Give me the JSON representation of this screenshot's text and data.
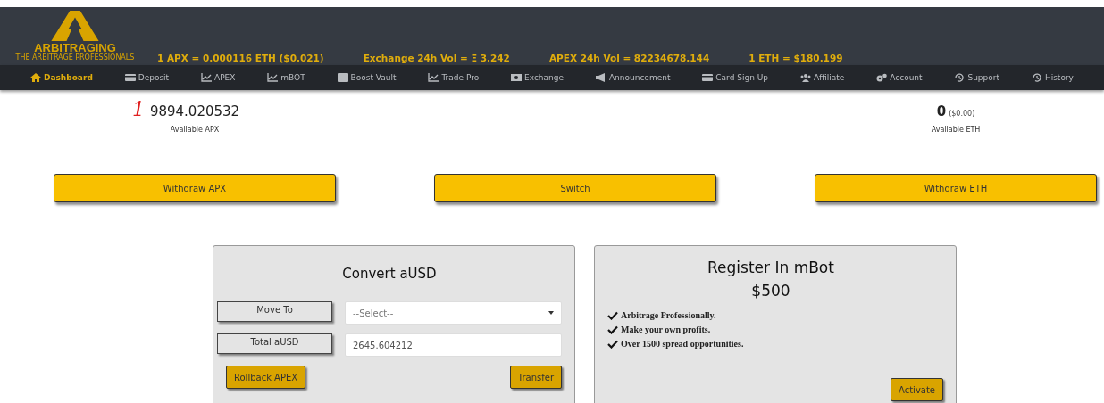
{
  "header": {
    "logo": {
      "name": "ARBITRAGING",
      "tagline": "THE ARBITRAGE PROFESSIONALS"
    },
    "tickers": [
      "1 APX = 0.000116 ETH ($0.021)",
      "Exchange 24h Vol = Ξ 3.242",
      "APEX 24h Vol = 82234678.144",
      "1 ETH = $180.199"
    ]
  },
  "nav": [
    {
      "label": "Dashboard",
      "selected": true
    },
    {
      "label": "Deposit",
      "selected": false
    },
    {
      "label": "APEX",
      "selected": false
    },
    {
      "label": "mBOT",
      "selected": false
    },
    {
      "label": "Boost Vault",
      "selected": false
    },
    {
      "label": "Trade Pro",
      "selected": false
    },
    {
      "label": "Exchange",
      "selected": false
    },
    {
      "label": "Announcement",
      "selected": false
    },
    {
      "label": "Card Sign Up",
      "selected": false
    },
    {
      "label": "Affiliate",
      "selected": false
    },
    {
      "label": "Account",
      "selected": false
    },
    {
      "label": "Support",
      "selected": false
    },
    {
      "label": "History",
      "selected": false
    }
  ],
  "balances": [
    {
      "annotation": "1",
      "amount": "9894.020532",
      "label": "Available APX"
    },
    {
      "amount": "0",
      "usd": "($0.00)",
      "label": "Available ETH"
    }
  ],
  "actions": [
    "Withdraw APX",
    "Switch",
    "Withdraw ETH"
  ],
  "convert_card": {
    "title": "Convert aUSD",
    "move_to": {
      "label": "Move To",
      "placeholder": "--Select--"
    },
    "total": {
      "label": "Total aUSD",
      "value": "2645.604212"
    },
    "buttons": [
      "Rollback APEX",
      "Transfer"
    ]
  },
  "register_card": {
    "title": "Register In mBot",
    "price": "$500",
    "features": [
      "Arbitrage Professionally.",
      "Make your own profits.",
      "Over 1500 spread opportunities."
    ],
    "button": "Activate"
  }
}
